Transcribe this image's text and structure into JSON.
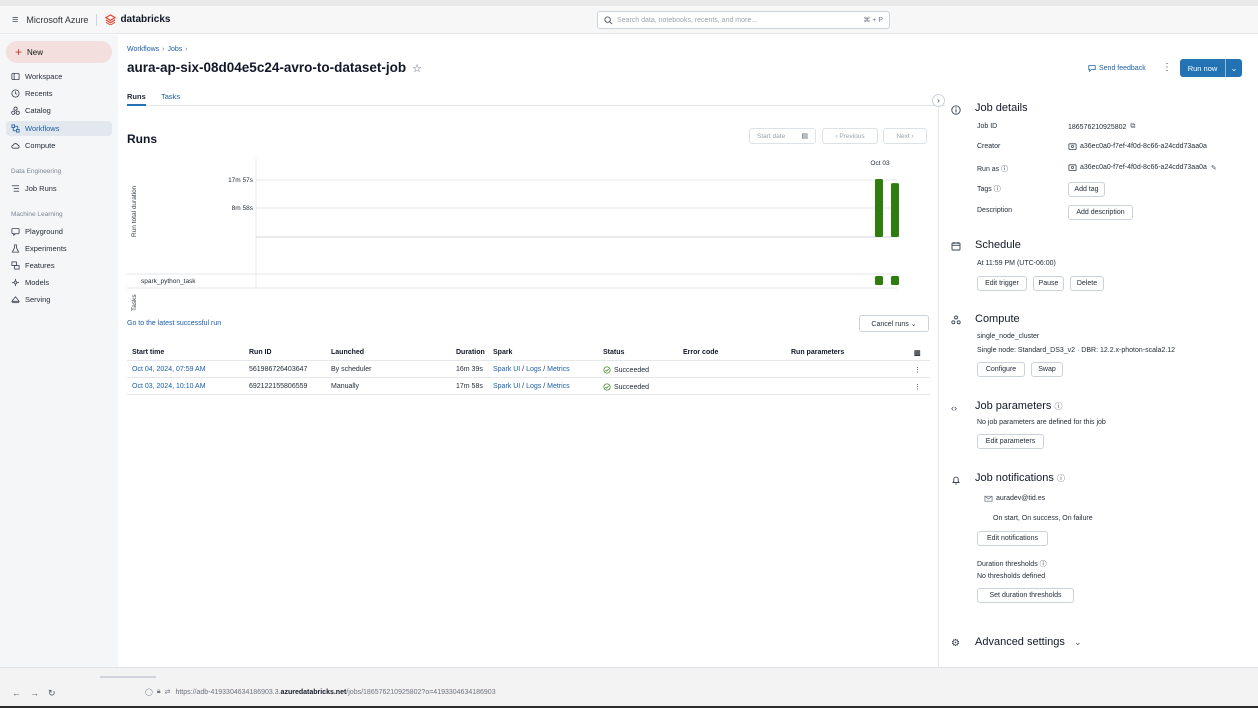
{
  "topbar": {
    "brand": "Microsoft Azure",
    "product": "databricks",
    "search_placeholder": "Search data, notebooks, recents, and more...",
    "search_shortcut": "⌘ + P"
  },
  "sidebar": {
    "new_label": "New",
    "items": [
      {
        "label": "Workspace",
        "icon": "folder-icon"
      },
      {
        "label": "Recents",
        "icon": "clock-icon"
      },
      {
        "label": "Catalog",
        "icon": "catalog-icon"
      },
      {
        "label": "Workflows",
        "icon": "workflows-icon",
        "active": true
      },
      {
        "label": "Compute",
        "icon": "cloud-icon"
      }
    ],
    "section_data_engineering": "Data Engineering",
    "data_engineering_items": [
      {
        "label": "Job Runs",
        "icon": "list-icon"
      }
    ],
    "section_machine_learning": "Machine Learning",
    "ml_items": [
      {
        "label": "Playground",
        "icon": "chat-icon"
      },
      {
        "label": "Experiments",
        "icon": "flask-icon"
      },
      {
        "label": "Features",
        "icon": "features-icon"
      },
      {
        "label": "Models",
        "icon": "models-icon"
      },
      {
        "label": "Serving",
        "icon": "serving-icon"
      }
    ]
  },
  "header": {
    "breadcrumb": [
      "Workflows",
      "Jobs"
    ],
    "title": "aura-ap-six-08d04e5c24-avro-to-dataset-job",
    "send_feedback": "Send feedback",
    "run_now": "Run now"
  },
  "tabs": [
    "Runs",
    "Tasks"
  ],
  "runs": {
    "heading": "Runs",
    "start_date_placeholder": "Start date",
    "previous": "‹  Previous",
    "next": "Next  ›",
    "latest_link": "Go to the latest successful run",
    "cancel_runs": "Cancel runs  ⌄"
  },
  "chart_data": {
    "type": "bar",
    "ylabel": "Run total duration",
    "y_ticks": [
      "17m 57s",
      "8m 58s"
    ],
    "x_tick": "Oct 03",
    "task_row_label": "spark_python_task",
    "tasks_label": "Tasks",
    "series": [
      {
        "name": "Run total duration",
        "values": [
          1077,
          999
        ]
      }
    ],
    "categories": [
      "Oct 03, 2024, 10:10 AM",
      "Oct 04, 2024, 07:59 AM"
    ],
    "bar_color": "#2e7d0f",
    "task_statuses": [
      "Succeeded",
      "Succeeded"
    ]
  },
  "table": {
    "headers": [
      "Start time",
      "Run ID",
      "Launched",
      "Duration",
      "Spark",
      "Status",
      "Error code",
      "Run parameters"
    ],
    "rows": [
      {
        "start": "Oct 04, 2024, 07:59 AM",
        "run_id": "561986726403647",
        "launched": "By scheduler",
        "duration": "16m 39s",
        "spark_ui": "Spark UI",
        "logs": "Logs",
        "metrics": "Metrics",
        "status": "Succeeded"
      },
      {
        "start": "Oct 03, 2024, 10:10 AM",
        "run_id": "692122155806559",
        "launched": "Manually",
        "duration": "17m 58s",
        "spark_ui": "Spark UI",
        "logs": "Logs",
        "metrics": "Metrics",
        "status": "Succeeded"
      }
    ]
  },
  "details": {
    "title": "Job details",
    "job_id_label": "Job ID",
    "job_id": "186576210925802",
    "creator_label": "Creator",
    "creator": "a36ec0a0-f7ef-4f0d-8c66-a24cdd73aa0a",
    "run_as_label": "Run as",
    "run_as": "a36ec0a0-f7ef-4f0d-8c66-a24cdd73aa0a",
    "tags_label": "Tags",
    "add_tag": "Add tag",
    "description_label": "Description",
    "add_description": "Add description"
  },
  "schedule": {
    "title": "Schedule",
    "text": "At 11:59 PM (UTC-06:00)",
    "edit_trigger": "Edit trigger",
    "pause": "Pause",
    "delete": "Delete"
  },
  "compute": {
    "title": "Compute",
    "cluster": "single_node_cluster",
    "spec": "Single node: Standard_DS3_v2 · DBR: 12.2.x-photon-scala2.12",
    "configure": "Configure",
    "swap": "Swap"
  },
  "job_parameters": {
    "title": "Job parameters",
    "text": "No job parameters are defined for this job",
    "edit": "Edit parameters"
  },
  "notifications": {
    "title": "Job notifications",
    "email": "auradev@tid.es",
    "events": "On start, On success, On failure",
    "edit": "Edit notifications",
    "duration_title": "Duration thresholds",
    "duration_text": "No thresholds defined",
    "set_thresholds": "Set duration thresholds"
  },
  "advanced": {
    "title": "Advanced settings"
  },
  "browser": {
    "url_prefix": "https://adb-4193304634186903.3.",
    "url_host": "azuredatabricks.net",
    "url_path": "/jobs/186576210925802?o=4193304634186903"
  }
}
